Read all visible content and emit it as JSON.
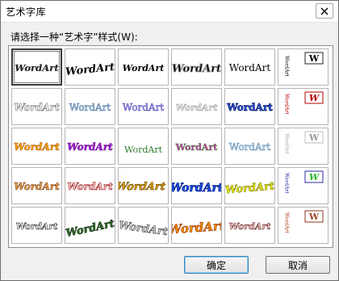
{
  "window": {
    "title": "艺术字库"
  },
  "prompt_label": "请选择一种“艺术字”样式(W):",
  "gallery": {
    "items": [
      "WordArt",
      "WordArt",
      "WordArt",
      "WordArt",
      "WordArt",
      "WordArt",
      "WordArt",
      "WordArt",
      "WordArt",
      "WordArt",
      "WordArt",
      "WordArt",
      "WordArt",
      "WordArt",
      "WordArt",
      "WordArt",
      "WordArt",
      "WordArt",
      "WordArt",
      "WordArt",
      "WordArt",
      "WordArt",
      "WordArt",
      "WordArt",
      "WordArt",
      "WordArt",
      "WordArt",
      "WordArt",
      "WordArt",
      "WordArt"
    ],
    "vertical_letter": "W",
    "selected_index": 0
  },
  "buttons": {
    "ok": "确定",
    "cancel": "取消"
  }
}
